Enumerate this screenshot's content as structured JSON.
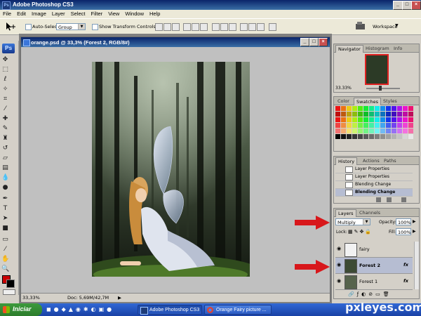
{
  "app": {
    "title": "Adobe Photoshop CS3"
  },
  "menu": [
    "File",
    "Edit",
    "Image",
    "Layer",
    "Select",
    "Filter",
    "View",
    "Window",
    "Help"
  ],
  "options": {
    "auto_select_label": "Auto-Select:",
    "auto_select_value": "Group",
    "show_transform_label": "Show Transform Controls",
    "workspace_label": "Workspace"
  },
  "document": {
    "title": "orange.psd @ 33,3% (Forest 2, RGB/8#)",
    "zoom": "33,33%",
    "doc_info": "Doc: 5,69M/42,7M"
  },
  "navigator": {
    "tabs": [
      "Navigator",
      "Histogram",
      "Info"
    ],
    "zoom": "33.33%"
  },
  "swatches": {
    "tabs": [
      "Color",
      "Swatches",
      "Styles"
    ]
  },
  "history": {
    "tabs": [
      "History",
      "Actions",
      "Paths"
    ],
    "items": [
      "Layer Properties",
      "Layer Properties",
      "Blending Change",
      "Blending Change"
    ]
  },
  "layers": {
    "tabs": [
      "Layers",
      "Channels"
    ],
    "blend_mode": "Multiply",
    "opacity_label": "Opacity:",
    "opacity": "100%",
    "lock_label": "Lock:",
    "fill_label": "Fill:",
    "fill": "100%",
    "items": [
      {
        "name": "fairy",
        "fx": ""
      },
      {
        "name": "Forest 2",
        "fx": "fx"
      },
      {
        "name": "Forest 1",
        "fx": "fx"
      }
    ]
  },
  "taskbar": {
    "start": "Iniciar",
    "items": [
      "Adobe Photoshop CS3",
      "Orange Fairy picture ..."
    ]
  },
  "watermark": "pxleyes.com",
  "colors": {
    "foreground": "#cc0000",
    "background": "#000000",
    "arrow": "#d8171b",
    "title_blue": "#0a246a"
  }
}
